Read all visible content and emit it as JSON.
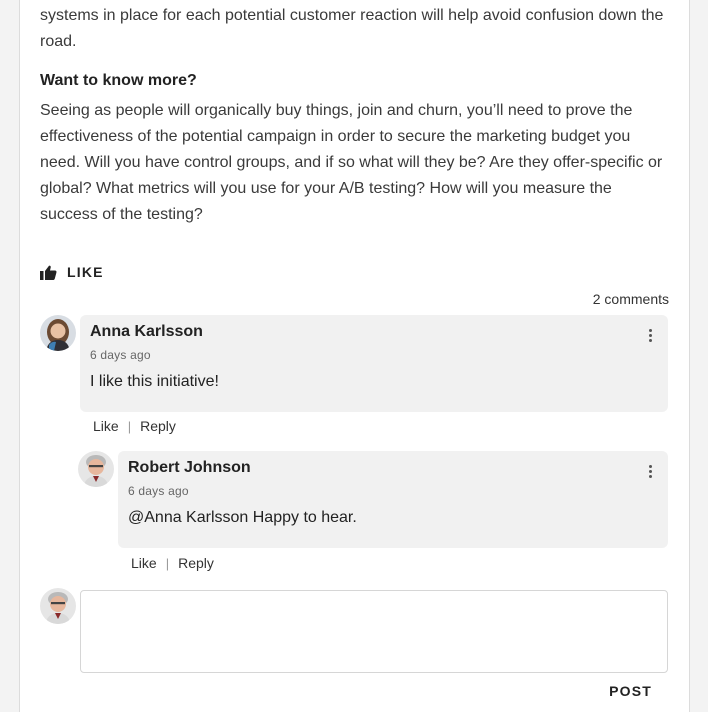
{
  "article": {
    "paragraph_1": "systems in place for each potential customer reaction will help avoid confusion down the road.",
    "heading": "Want to know more?",
    "paragraph_2": "Seeing as people will organically buy things, join and churn, you’ll need to prove the effectiveness of the potential campaign in order to secure the marketing budget you need. Will you have control groups, and if so what will they be? Are they offer-specific or global? What metrics will you use for your A/B testing? How will you measure the success of the testing?"
  },
  "like_button": {
    "label": "LIKE",
    "icon": "thumbs-up-icon"
  },
  "comments": {
    "count_label": "2 comments",
    "items": [
      {
        "author": "Anna Karlsson",
        "time": "6 days ago",
        "text": "I like this initiative!",
        "like_label": "Like",
        "reply_label": "Reply",
        "separator": "|"
      },
      {
        "author": "Robert Johnson",
        "time": "6 days ago",
        "text": "@Anna Karlsson Happy to hear.",
        "like_label": "Like",
        "reply_label": "Reply",
        "separator": "|"
      }
    ]
  },
  "composer": {
    "post_label": "POST"
  },
  "colors": {
    "bubble_bg": "#f1f1f1",
    "page_bg": "#f3f3f3",
    "text": "#222222"
  }
}
